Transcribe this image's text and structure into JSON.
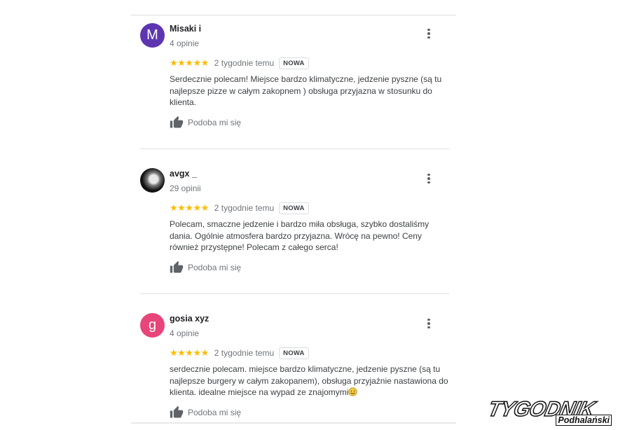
{
  "reviews": [
    {
      "avatar_letter": "M",
      "avatar_color": "#5e35b1",
      "name": "Misaki i",
      "review_count": "4 opinie",
      "stars": "★★★★★",
      "rating": 5,
      "time": "2 tygodnie temu",
      "badge": "NOWA",
      "text": "Serdecznie polecam! Miejsce bardzo klimatyczne, jedzenie pyszne (są tu najlepsze pizze w całym zakopnem ) obsługa przyjazna w stosunku do klienta.",
      "like_label": "Podoba mi się"
    },
    {
      "avatar_letter": "",
      "avatar_color": "#111111",
      "name": "avgx _",
      "review_count": "29 opinii",
      "stars": "★★★★★",
      "rating": 5,
      "time": "2 tygodnie temu",
      "badge": "NOWA",
      "text": "Polecam, smaczne jedzenie i bardzo miła obsługa, szybko dostaliśmy dania. Ogólnie atmosfera bardzo przyjazna. Wrócę na pewno! Ceny również przystępne! Polecam z całego serca!",
      "like_label": "Podoba mi się"
    },
    {
      "avatar_letter": "g",
      "avatar_color": "#e8457a",
      "name": "gosia xyz",
      "review_count": "4 opinie",
      "stars": "★★★★★",
      "rating": 5,
      "time": "2 tygodnie temu",
      "badge": "NOWA",
      "text": "serdecznie polecam. miejsce bardzo klimatyczne, jedzenie pyszne (są tu najlepsze burgery w całym zakopanem), obsługa przyjaźnie nastawiona do klienta. idealne miejsce na wypad ze znajomymi",
      "like_label": "Podoba mi się"
    }
  ],
  "logo": {
    "main": "TYGODNIK",
    "sub": "Podhalański"
  },
  "colors": {
    "star": "#fbbc04",
    "secondary_text": "#70757a",
    "body_text": "#3c4043"
  }
}
